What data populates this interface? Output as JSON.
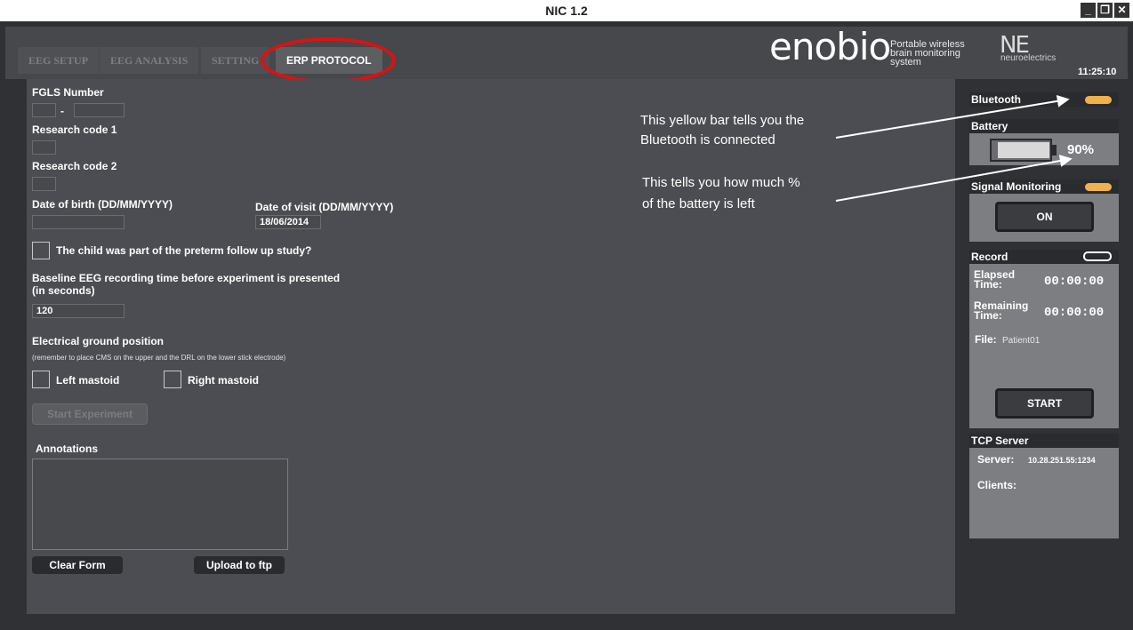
{
  "window": {
    "title": "NIC 1.2",
    "min": "_",
    "max": "❐",
    "close": "✕"
  },
  "tabs": [
    {
      "label": "EEG SETUP"
    },
    {
      "label": "EEG ANALYSIS"
    },
    {
      "label": "SETTING"
    },
    {
      "label": "ERP PROTOCOL"
    }
  ],
  "brand": {
    "logo": "enobio",
    "tagline": "Portable wireless brain monitoring system",
    "company": "NE",
    "company_sub": "neuroelectrics",
    "clock": "11:25:10"
  },
  "form": {
    "fgls_label": "FGLS Number",
    "fgls_sep": "-",
    "research1_label": "Research code 1",
    "research2_label": "Research code 2",
    "dob_label": "Date of birth (DD/MM/YYYY)",
    "visit_label": "Date of visit (DD/MM/YYYY)",
    "visit_value": "18/06/2014",
    "preterm_label": "The child was part of the preterm follow up study?",
    "baseline_label1": "Baseline EEG recording time before experiment is presented",
    "baseline_label2": "(in seconds)",
    "baseline_value": "120",
    "ground_label": "Electrical ground position",
    "ground_note": "(remember to place CMS on the upper and the DRL on the lower stick electrode)",
    "left_mastoid": "Left mastoid",
    "right_mastoid": "Right mastoid",
    "start_exp": "Start Experiment",
    "annotations_label": "Annotations",
    "clear_form": "Clear Form",
    "upload": "Upload to ftp"
  },
  "annotations": {
    "bt_line1": "This yellow bar tells you the",
    "bt_line2": "Bluetooth is connected",
    "bat_line1": "This tells you how much %",
    "bat_line2": "of the battery is left"
  },
  "panel": {
    "bluetooth": "Bluetooth",
    "battery": "Battery",
    "battery_value": "90%",
    "battery_level": 0.9,
    "signal": "Signal Monitoring",
    "signal_btn": "ON",
    "record": "Record",
    "elapsed_label": "Elapsed Time:",
    "elapsed_value": "00:00:00",
    "remaining_label": "Remaining Time:",
    "remaining_value": "00:00:00",
    "file_label": "File:",
    "file_value": "Patient01",
    "start": "START",
    "tcp": "TCP Server",
    "server_label": "Server:",
    "server_value": "10.28.251.55:1234",
    "clients_label": "Clients:"
  },
  "colors": {
    "accent": "#f0b04a",
    "highlight": "#e01010",
    "panel": "#4b4d52"
  }
}
